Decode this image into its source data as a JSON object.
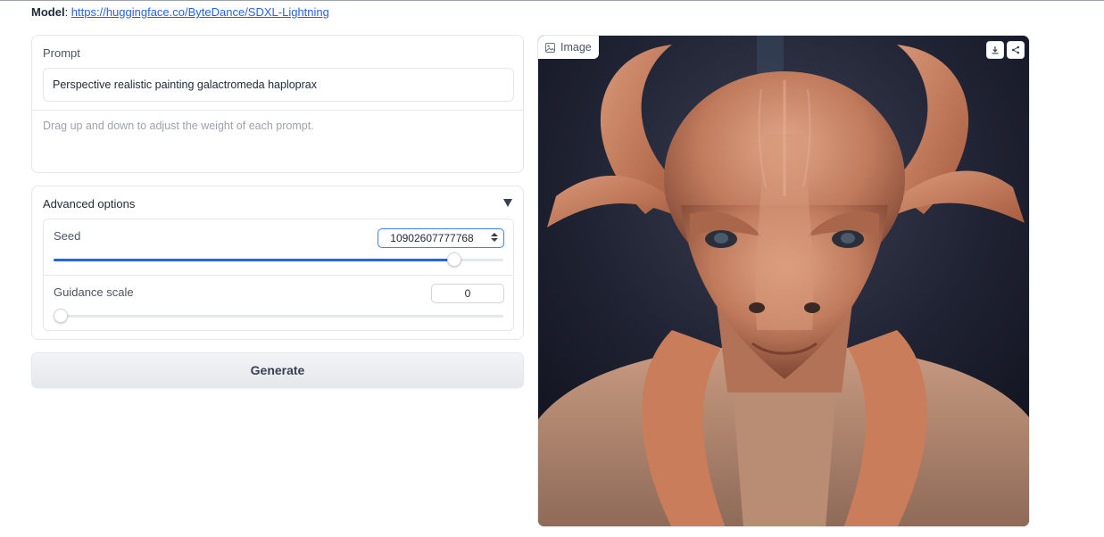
{
  "header": {
    "model_label": "Model",
    "model_link": "https://huggingface.co/ByteDance/SDXL-Lightning"
  },
  "prompt": {
    "label": "Prompt",
    "value": "Perspective realistic painting galactromeda haploprax",
    "hint": "Drag up and down to adjust the weight of each prompt."
  },
  "advanced": {
    "title": "Advanced options",
    "seed": {
      "label": "Seed",
      "value": "10902607777768",
      "fraction": 0.89
    },
    "guidance": {
      "label": "Guidance scale",
      "value": "0",
      "fraction": 0.0
    }
  },
  "generate_label": "Generate",
  "output": {
    "label": "Image",
    "download_icon": "download-icon",
    "share_icon": "share-icon"
  },
  "colors": {
    "accent": "#2563eb",
    "image_bg": "#1b1d29",
    "skin": "#c98a6e"
  }
}
